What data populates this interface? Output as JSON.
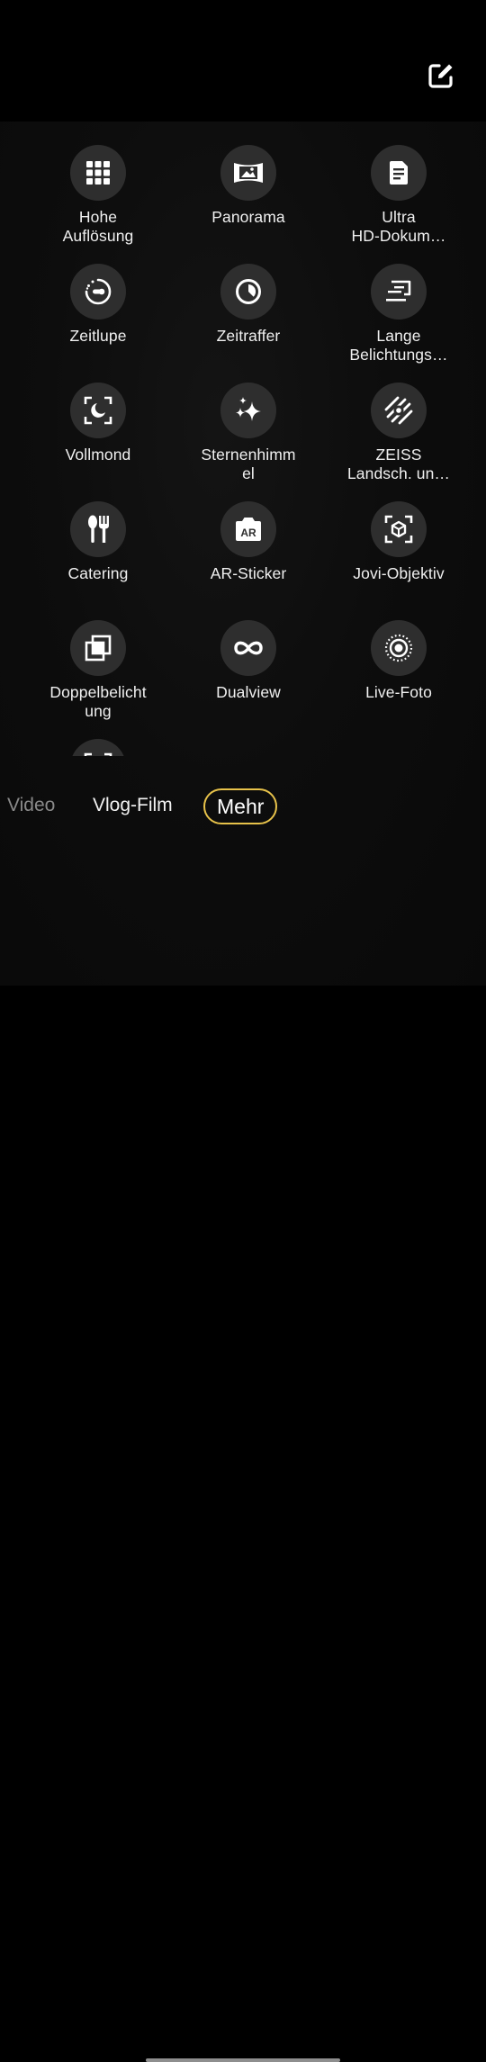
{
  "header": {
    "edit_icon": "edit-icon"
  },
  "modes": [
    {
      "id": "hohe-aufloesung",
      "label": "Hohe\nAuflösung",
      "icon": "grid-icon"
    },
    {
      "id": "panorama",
      "label": "Panorama",
      "icon": "panorama-icon"
    },
    {
      "id": "ultra-hd-dokument",
      "label": "Ultra\nHD-Dokum…",
      "icon": "document-icon"
    },
    {
      "id": "zeitlupe",
      "label": "Zeitlupe",
      "icon": "slow-motion-icon"
    },
    {
      "id": "zeitraffer",
      "label": "Zeitraffer",
      "icon": "timelapse-icon"
    },
    {
      "id": "lange-belichtung",
      "label": "Lange\nBelichtungs…",
      "icon": "long-exposure-icon"
    },
    {
      "id": "vollmond",
      "label": "Vollmond",
      "icon": "moon-focus-icon"
    },
    {
      "id": "sternenhimmel",
      "label": "Sternenhimm\nel",
      "icon": "sparkles-icon"
    },
    {
      "id": "zeiss-landschaft",
      "label": "ZEISS\nLandsch. un…",
      "icon": "zeiss-landscape-icon"
    },
    {
      "id": "catering",
      "label": "Catering",
      "icon": "cutlery-icon"
    },
    {
      "id": "ar-sticker",
      "label": "AR-Sticker",
      "icon": "ar-camera-icon"
    },
    {
      "id": "jovi-objektiv",
      "label": "Jovi-Objektiv",
      "icon": "lens-scan-icon"
    },
    {
      "id": "doppelbelichtung",
      "label": "Doppelbelicht\nung",
      "icon": "double-exposure-icon"
    },
    {
      "id": "dualview",
      "label": "Dualview",
      "icon": "infinity-icon"
    },
    {
      "id": "live-foto",
      "label": "Live-Foto",
      "icon": "live-photo-icon"
    }
  ],
  "mode_bar": {
    "video": "Video",
    "vlog": "Vlog-Film",
    "mehr": "Mehr"
  },
  "colors": {
    "accent": "#e7c24a",
    "tile": "#2e2e2e",
    "background": "#000000"
  }
}
